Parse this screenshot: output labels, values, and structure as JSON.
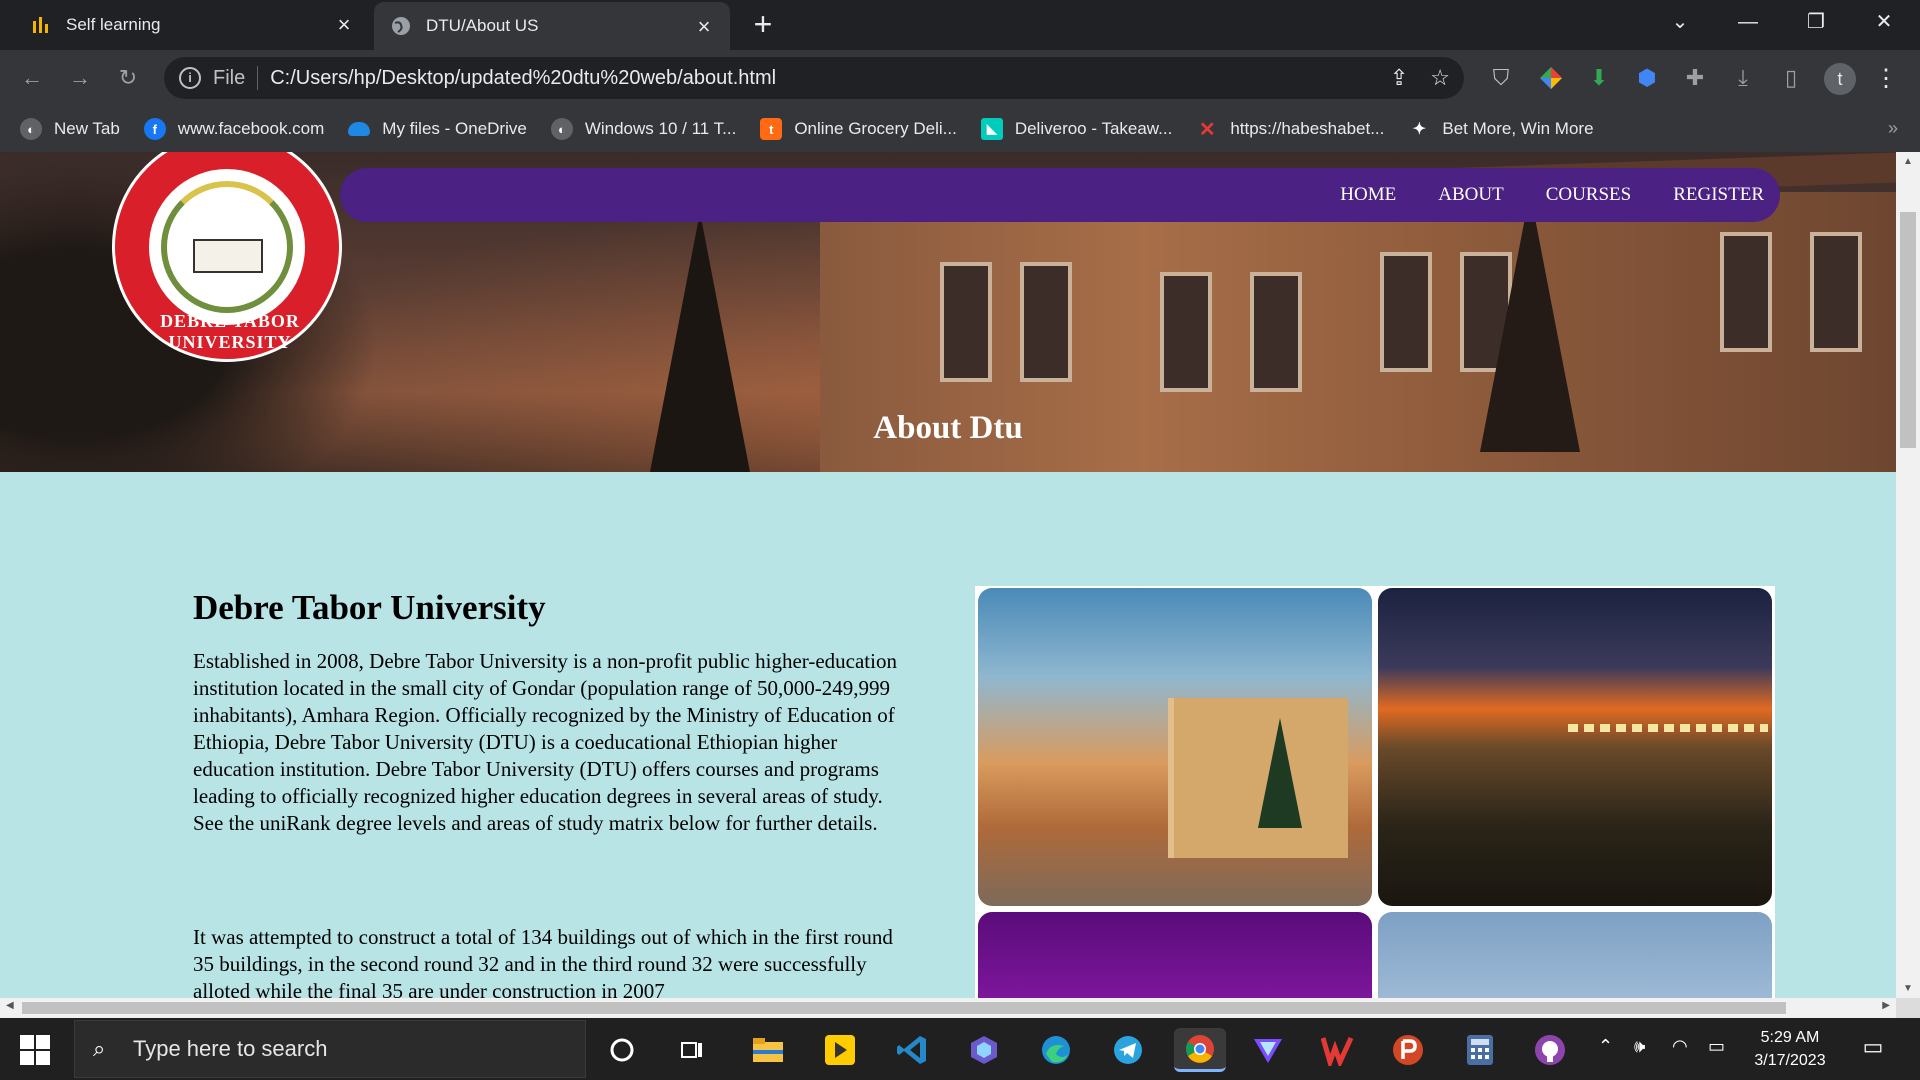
{
  "browser": {
    "tabs": [
      {
        "title": "Self learning",
        "icon": "chart-bars-icon"
      },
      {
        "title": "DTU/About US",
        "icon": "globe-icon"
      }
    ],
    "address": {
      "scheme_label": "File",
      "url": "C:/Users/hp/Desktop/updated%20dtu%20web/about.html"
    },
    "profile_initial": "t",
    "bookmarks": [
      {
        "label": "New Tab",
        "icon": "globe-icon",
        "color": "#5f6368"
      },
      {
        "label": "www.facebook.com",
        "icon": "facebook-icon",
        "color": "#1877f2"
      },
      {
        "label": "My files - OneDrive",
        "icon": "onedrive-icon",
        "color": "#1e88e5"
      },
      {
        "label": "Windows 10 / 11 T...",
        "icon": "globe-icon",
        "color": "#5f6368"
      },
      {
        "label": "Online Grocery Deli...",
        "icon": "grocery-icon",
        "color": "#ff6a13"
      },
      {
        "label": "Deliveroo - Takeaw...",
        "icon": "deliveroo-icon",
        "color": "#00ccbc"
      },
      {
        "label": "https://habeshabet...",
        "icon": "habeshabet-icon",
        "color": "#e53935"
      },
      {
        "label": "Bet More, Win More",
        "icon": "bet-icon",
        "color": "#1e88e5"
      }
    ]
  },
  "page": {
    "logo_text": "DEBRE TABOR UNIVERSITY",
    "nav": [
      "HOME",
      "ABOUT",
      "COURSES",
      "REGISTER"
    ],
    "hero_title": "About Dtu",
    "section_title": "Debre Tabor University",
    "paragraphs": [
      "Established in 2008, Debre Tabor University is a non-profit public higher-education institution located in the small city of Gondar (population range of 50,000-249,999 inhabitants), Amhara Region. Officially recognized by the Ministry of Education of Ethiopia, Debre Tabor University (DTU) is a coeducational Ethiopian higher education institution. Debre Tabor University (DTU) offers courses and programs leading to officially recognized higher education degrees in several areas of study. See the uniRank degree levels and areas of study matrix below for further details.",
      "It was attempted to construct a total of 134 buildings out of which in the first round 35 buildings, in the second round 32 and in the third round 32 were successfully alloted while the final 35 are under construction in 2007"
    ],
    "colors": {
      "nav_bg": "#4b2183",
      "content_bg": "#b8e4e6",
      "logo_red": "#d9202a"
    }
  },
  "taskbar": {
    "search_placeholder": "Type here to search",
    "time": "5:29 AM",
    "date": "3/17/2023",
    "apps": [
      "cortana-icon",
      "task-view-icon",
      "file-explorer-icon",
      "player-icon",
      "vscode-icon",
      "copilot-icon",
      "edge-icon",
      "telegram-icon",
      "chrome-icon",
      "vpn-icon",
      "wps-icon",
      "powerpoint-icon",
      "calculator-icon",
      "github-icon"
    ]
  }
}
